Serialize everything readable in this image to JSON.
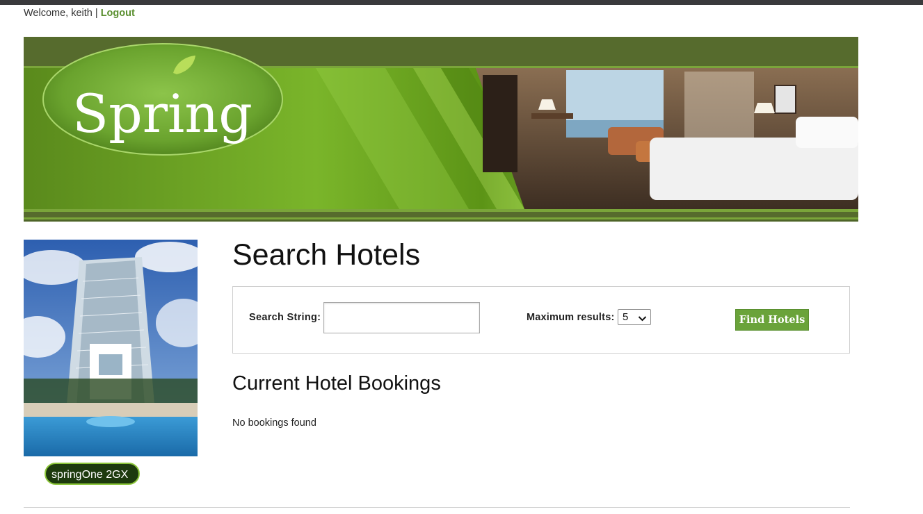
{
  "header": {
    "welcome_text": "Welcome, keith |",
    "logout_label": "Logout"
  },
  "banner": {
    "logo_text": "Spring"
  },
  "main": {
    "title": "Search Hotels",
    "search": {
      "label": "Search String:",
      "value": "",
      "placeholder": "",
      "max_results_label": "Maximum results:",
      "max_results_value": "5",
      "submit_label": "Find Hotels"
    },
    "bookings_title": "Current Hotel Bookings",
    "bookings_empty": "No bookings found"
  },
  "sidebar": {
    "badge_text": "springOne 2GX"
  },
  "colors": {
    "accent": "#6aa33a",
    "link": "#5a8f2f",
    "banner_dark": "#4e6428"
  }
}
